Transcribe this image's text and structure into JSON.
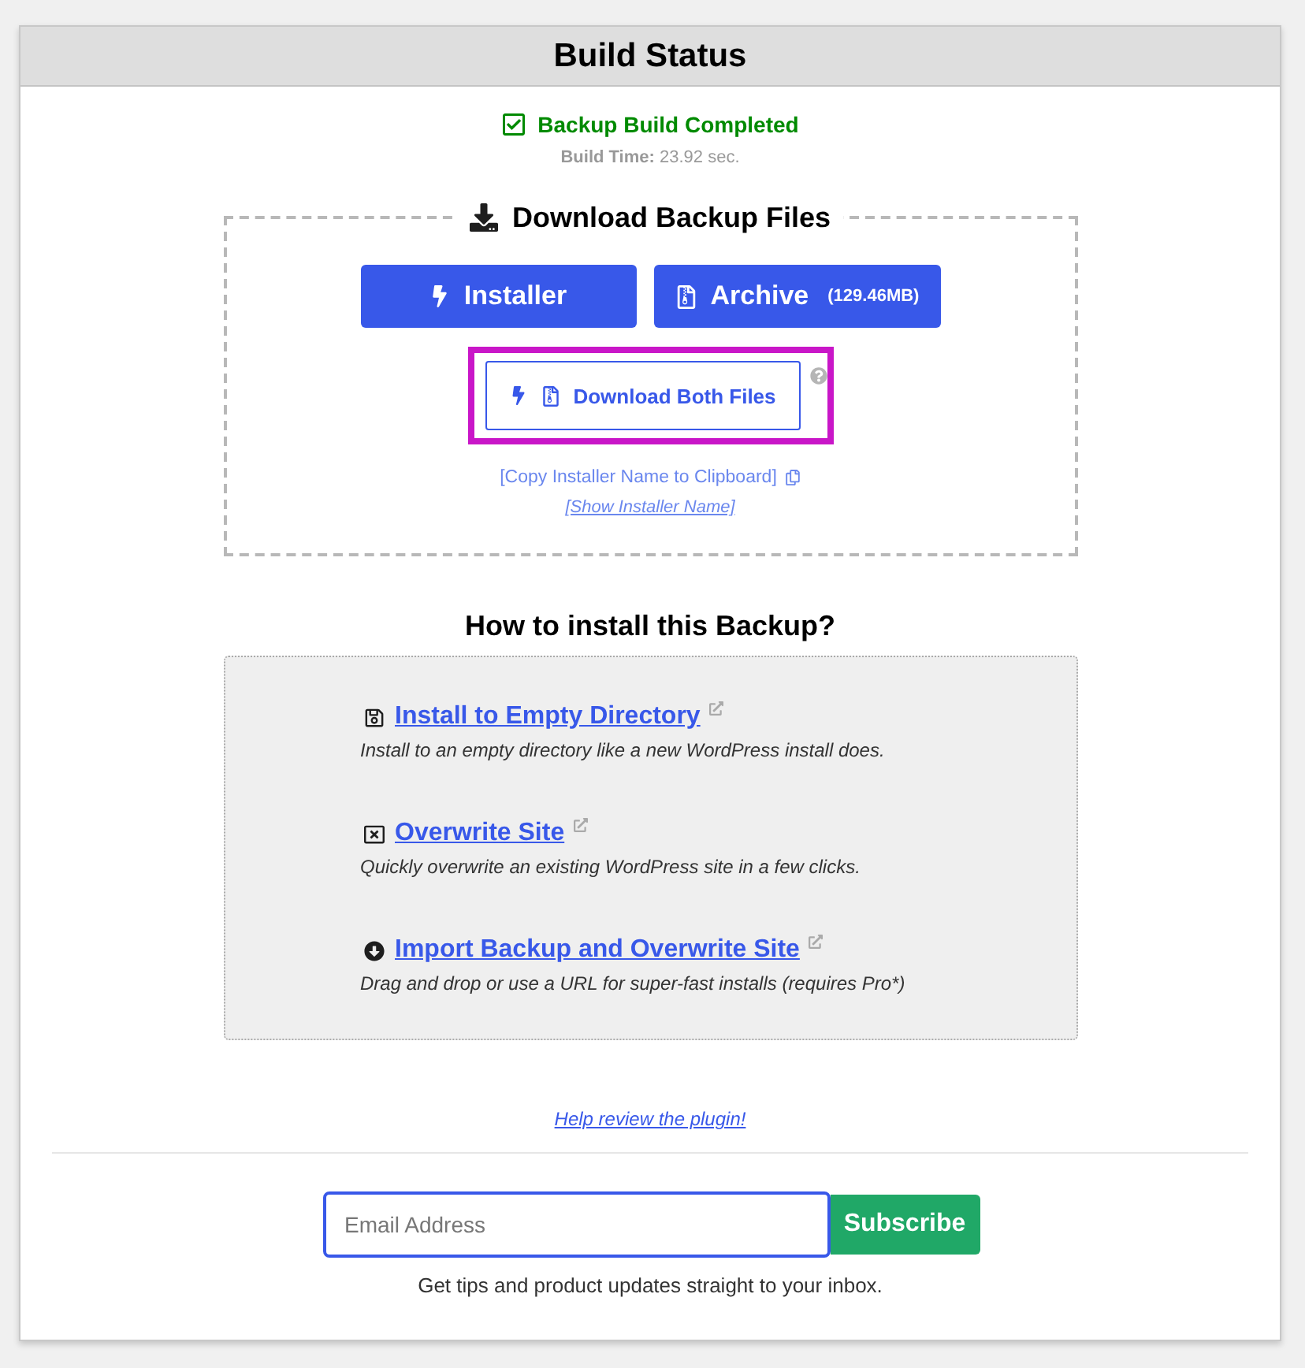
{
  "window": {
    "title": "Build Status"
  },
  "status": {
    "message": "Backup Build Completed",
    "build_time": "**Build Time:** 23.92 sec."
  },
  "download": {
    "title": "Download Backup Files",
    "buttons": [
      {
        "kind": "installer",
        "label": "Installer"
      },
      {
        "kind": "archive",
        "label": "Archive",
        "size": "(129.46MB)"
      }
    ],
    "both_button": {
      "label": "Download Both Files",
      "highlighted": true
    },
    "copy_link": "[Copy Installer Name to Clipboard]",
    "show_link": "[Show Installer Name]"
  },
  "install": {
    "title": "How to install this Backup?",
    "methods": [
      {
        "kind": "empty_directory",
        "label": "Install to Empty Directory",
        "description": "Install to an empty directory like a new WordPress install does."
      },
      {
        "kind": "overwrite",
        "label": "Overwrite Site",
        "description": "Quickly overwrite an existing WordPress site in a few clicks."
      },
      {
        "kind": "import",
        "label": "Import Backup and Overwrite Site",
        "description": "Drag and drop or use a URL for super-fast installs (requires Pro*)"
      }
    ]
  },
  "review_link": "Help review the plugin!",
  "subscribe": {
    "email_field": {
      "placeholder": "Email Address",
      "focused": true
    },
    "button": "Subscribe",
    "note": "Get tips and product updates straight to your inbox."
  }
}
